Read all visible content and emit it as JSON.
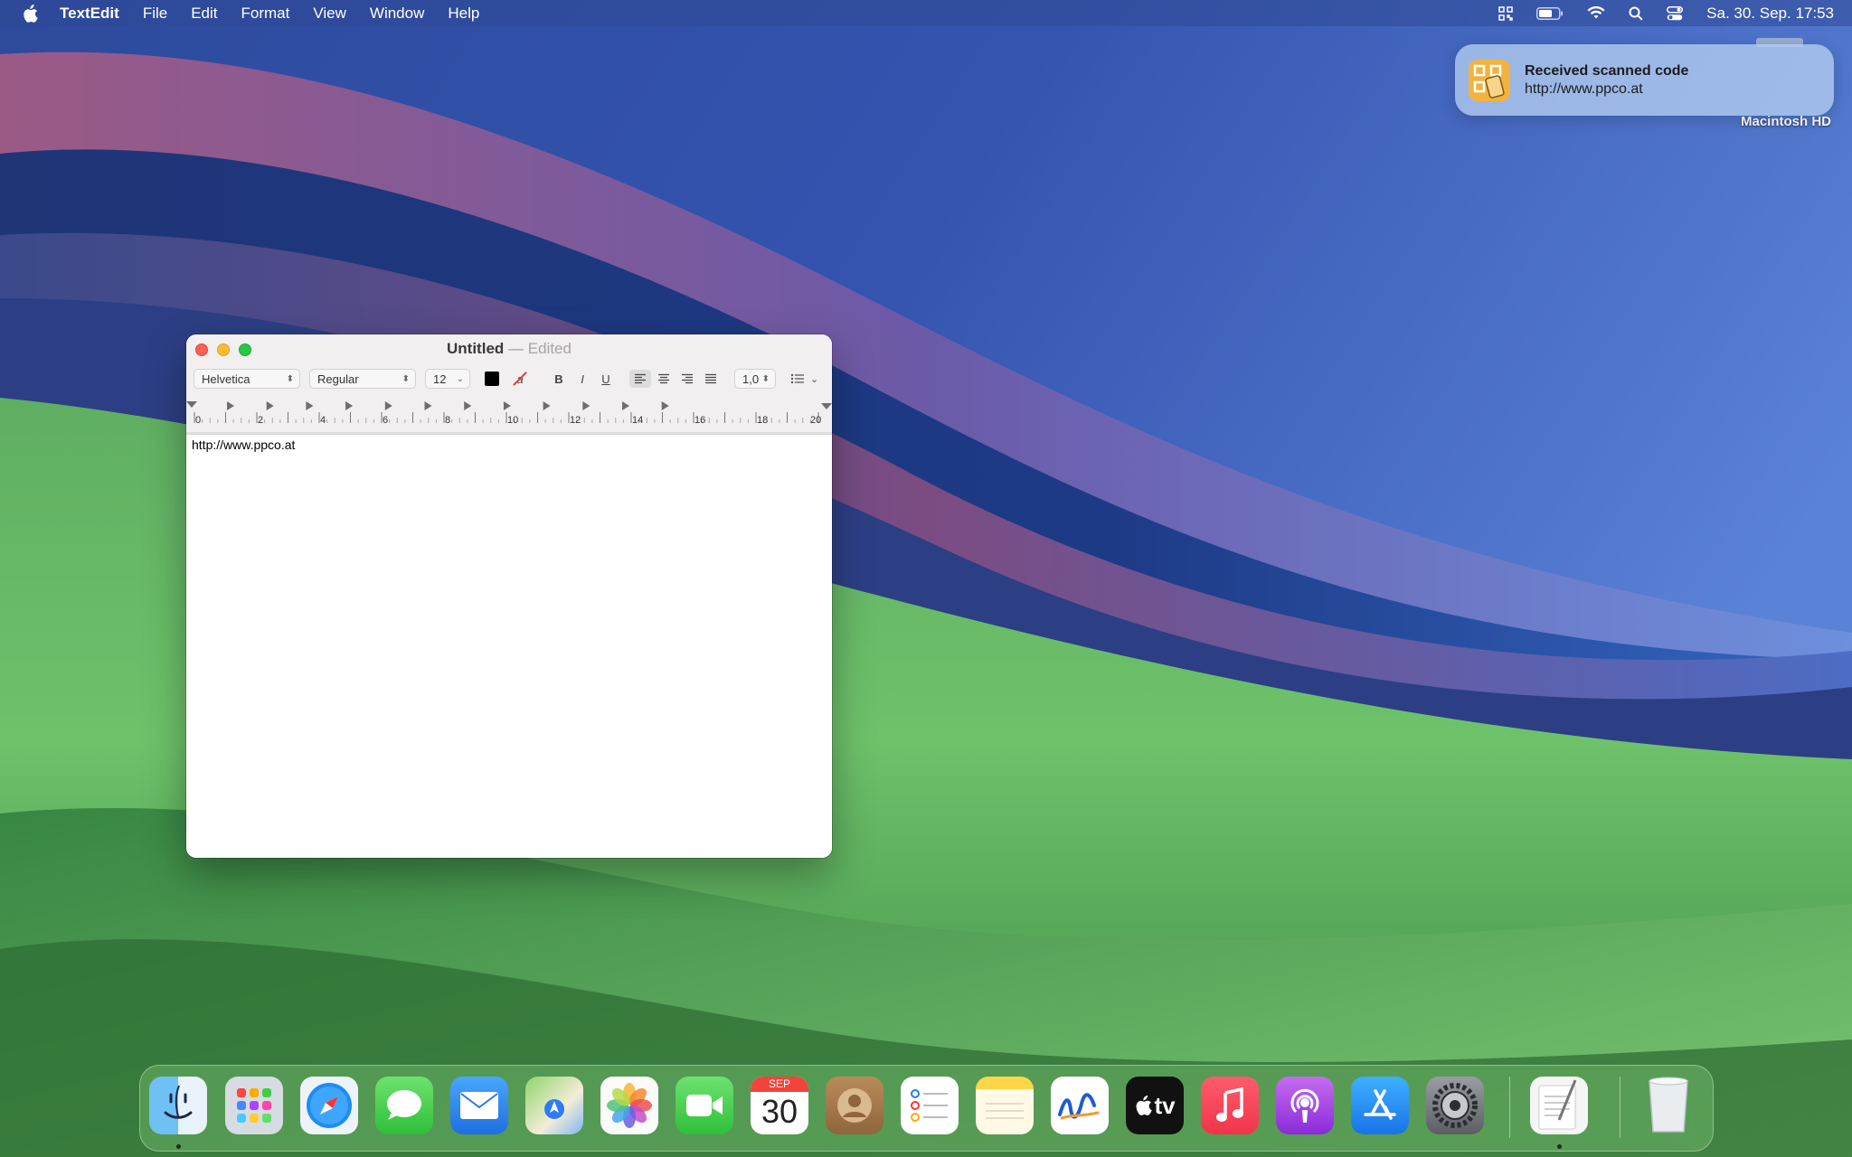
{
  "menubar": {
    "app_name": "TextEdit",
    "menus": [
      "File",
      "Edit",
      "Format",
      "View",
      "Window",
      "Help"
    ],
    "clock": "Sa. 30. Sep.  17:53",
    "status_icons": [
      "qr-scanner-icon",
      "battery-icon",
      "wifi-icon",
      "spotlight-search-icon",
      "control-center-icon"
    ]
  },
  "notification": {
    "title": "Received scanned code",
    "body": "http://www.ppco.at",
    "icon": "qr-code-scanner-icon"
  },
  "desktop": {
    "disk_label": "Macintosh HD"
  },
  "window": {
    "title": "Untitled",
    "separator": "—",
    "status": "Edited",
    "toolbar": {
      "font_family": "Helvetica",
      "font_style": "Regular",
      "font_size": "12",
      "text_color": "#000000",
      "bold_label": "B",
      "italic_label": "I",
      "underline_label": "U",
      "highlight_label": "a",
      "alignment": "left",
      "line_spacing": "1,0"
    },
    "ruler_labels": [
      "0",
      "2",
      "4",
      "6",
      "8",
      "10",
      "12",
      "14",
      "16",
      "18",
      "20"
    ],
    "document_text": "http://www.ppco.at"
  },
  "dock": {
    "apps": [
      {
        "name": "Finder",
        "icon": "finder-icon",
        "running": true
      },
      {
        "name": "Launchpad",
        "icon": "launchpad-icon",
        "running": false
      },
      {
        "name": "Safari",
        "icon": "safari-icon",
        "running": false
      },
      {
        "name": "Messages",
        "icon": "messages-icon",
        "running": false
      },
      {
        "name": "Mail",
        "icon": "mail-icon",
        "running": false
      },
      {
        "name": "Maps",
        "icon": "maps-icon",
        "running": false
      },
      {
        "name": "Photos",
        "icon": "photos-icon",
        "running": false
      },
      {
        "name": "FaceTime",
        "icon": "facetime-icon",
        "running": false
      },
      {
        "name": "Calendar",
        "icon": "calendar-icon",
        "running": false,
        "month": "SEP",
        "day": "30"
      },
      {
        "name": "Contacts",
        "icon": "contacts-icon",
        "running": false
      },
      {
        "name": "Reminders",
        "icon": "reminders-icon",
        "running": false
      },
      {
        "name": "Notes",
        "icon": "notes-icon",
        "running": false
      },
      {
        "name": "Freeform",
        "icon": "freeform-icon",
        "running": false
      },
      {
        "name": "TV",
        "icon": "apple-tv-icon",
        "running": false,
        "label": "tv"
      },
      {
        "name": "Music",
        "icon": "music-icon",
        "running": false
      },
      {
        "name": "Podcasts",
        "icon": "podcasts-icon",
        "running": false
      },
      {
        "name": "App Store",
        "icon": "app-store-icon",
        "running": false
      },
      {
        "name": "System Settings",
        "icon": "system-settings-icon",
        "running": false
      },
      {
        "name": "TextEdit",
        "icon": "textedit-icon",
        "running": true
      },
      {
        "name": "Trash",
        "icon": "trash-icon",
        "running": false
      }
    ]
  },
  "colors": {
    "close": "#fe5f57",
    "minimize": "#febc2e",
    "maximize": "#28c840",
    "notification_icon": "#f2b33d"
  }
}
